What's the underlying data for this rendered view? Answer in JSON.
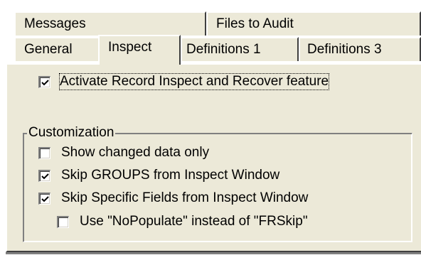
{
  "tabs": {
    "row_back": [
      {
        "label": "Messages"
      },
      {
        "label": "Files to Audit"
      }
    ],
    "row_front": [
      {
        "label": "General"
      },
      {
        "label": "Inspect"
      },
      {
        "label": "Definitions 1"
      },
      {
        "label": "Definitions 3"
      }
    ],
    "active": "Inspect"
  },
  "inspect": {
    "activate_label": "Activate Record Inspect and Recover feature",
    "activate_checked": true,
    "group_label": "Customization",
    "options": [
      {
        "label": "Show changed data only",
        "checked": false
      },
      {
        "label": "Skip GROUPS from Inspect Window",
        "checked": true
      },
      {
        "label": "Skip Specific Fields from Inspect Window",
        "checked": true
      },
      {
        "label": "Use \"NoPopulate\" instead of \"FRSkip\"",
        "checked": false
      }
    ]
  },
  "colors": {
    "face": "#ece9d8",
    "highlight": "#ffffff",
    "shadow": "#808080",
    "dark_shadow": "#404040"
  }
}
